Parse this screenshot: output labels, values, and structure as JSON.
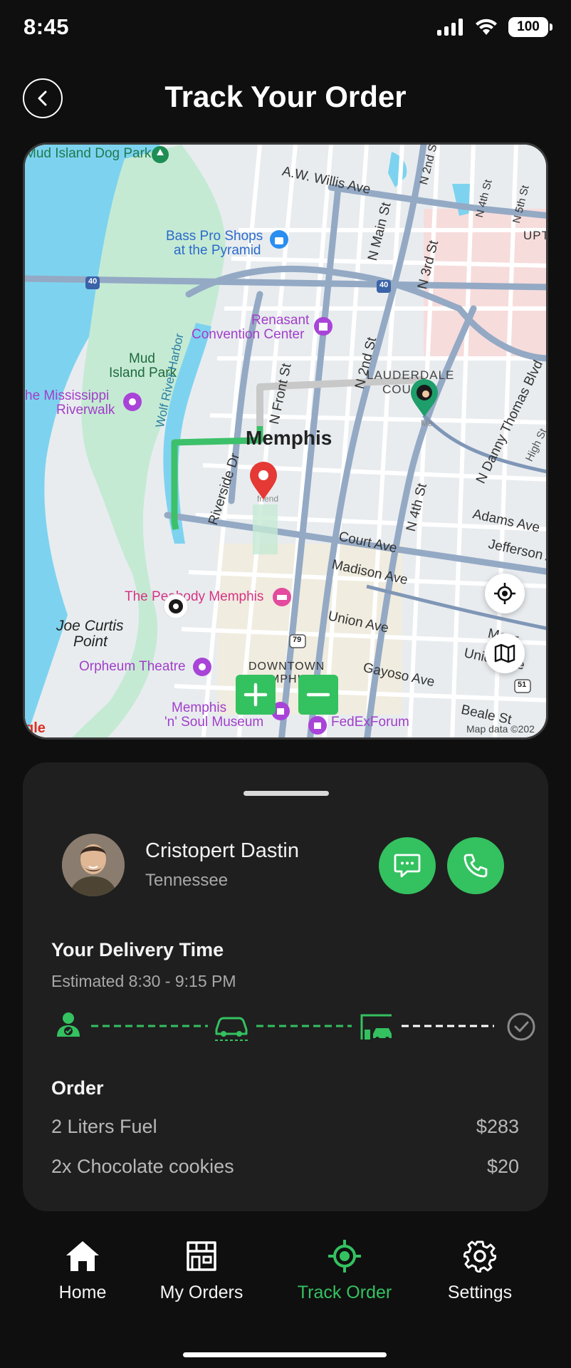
{
  "status_bar": {
    "time": "8:45",
    "battery": "100"
  },
  "header": {
    "title": "Track Your Order"
  },
  "map": {
    "labels": {
      "mud_island_dog_park": "Mud Island Dog Park",
      "aw_willis": "A.W. Willis Ave",
      "bass_pro": "Bass Pro Shops",
      "pyramid": "at the Pyramid",
      "renasant": "Renasant",
      "convention": "Convention Center",
      "mud": "Mud",
      "island_park": "Island Park",
      "mississippi": "he Mississippi",
      "riverwalk": "Riverwalk",
      "wolf_river": "Wolf River Harbor",
      "memphis": "Memphis",
      "lauderdale": "LAUDERDALE",
      "cou": "COU",
      "peabody": "The Peabody Memphis",
      "joe_curtis": "Joe Curtis",
      "point": "Point",
      "orpheum": "Orpheum Theatre",
      "downtown": "DOWNTOWN",
      "memphis_small": "MEMPHIS",
      "soul1": "Memphis",
      "soul2": "'n' Soul Museum",
      "fedex": "FedExForum",
      "court": "Court Ave",
      "madison": "Madison Ave",
      "union": "Union Ave",
      "union2": "Union Ave",
      "gayoso": "Gayoso Ave",
      "adams": "Adams Ave",
      "jefferson": "Jefferson A",
      "beale": "Beale St",
      "monroe": "Monr",
      "n_main": "N Main St",
      "n_2nd": "N 2nd St",
      "n_3rd": "N 3rd St",
      "n_4th": "N 4th St",
      "n_front": "N Front St",
      "riverside": "Riverside Dr",
      "danny_thomas": "N Danny Thomas Blvd",
      "high": "High St",
      "uptown": "UPT",
      "n_2nd_top": "N 2nd St",
      "n_4th_top": "N 4th St",
      "n_5th": "N 5th St",
      "map_data": "Map data ©202",
      "google": "gle",
      "me": "Me",
      "friend": "friend",
      "hwy40a": "40",
      "hwy40b": "40",
      "hwy79": "79",
      "hwy51": "51"
    }
  },
  "driver": {
    "name": "Cristopert Dastin",
    "location": "Tennessee"
  },
  "delivery": {
    "title": "Your Delivery Time",
    "estimate": "Estimated 8:30 - 9:15 PM"
  },
  "order": {
    "title": "Order",
    "items": [
      {
        "name": "2 Liters Fuel",
        "price": "$283"
      },
      {
        "name": "2x Chocolate cookies",
        "price": "$20"
      }
    ]
  },
  "nav": {
    "home": "Home",
    "orders": "My Orders",
    "track": "Track Order",
    "settings": "Settings"
  },
  "colors": {
    "accent": "#34c160",
    "background": "#0f0f0f",
    "card": "#1f1f1f"
  }
}
